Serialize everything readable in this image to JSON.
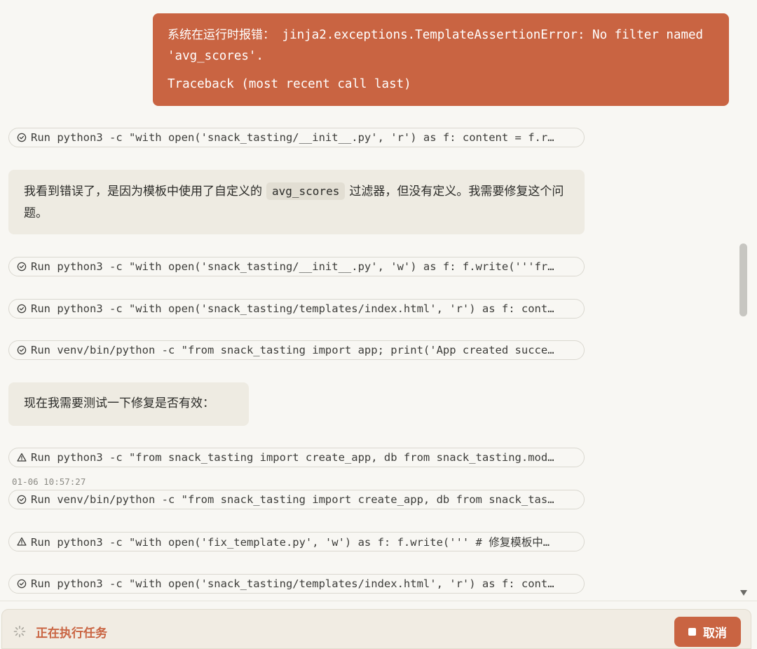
{
  "user_message": {
    "line1_prefix": "系统在运行时报错：",
    "line1_code": " jinja2.exceptions.TemplateAssertionError: No filter named 'avg_scores'.",
    "line2": "Traceback (most recent call last)"
  },
  "steps": [
    {
      "icon": "check-circle-icon",
      "text": "Run python3 -c \"with open('snack_tasting/__init__.py', 'r') as f: content = f.r…"
    },
    {
      "icon": "check-circle-icon",
      "text": "Run python3 -c \"with open('snack_tasting/__init__.py', 'w') as f: f.write('''fr…"
    },
    {
      "icon": "check-circle-icon",
      "text": "Run python3 -c \"with open('snack_tasting/templates/index.html', 'r') as f: cont…"
    },
    {
      "icon": "check-circle-icon",
      "text": "Run venv/bin/python -c \"from snack_tasting import app; print('App created succe…"
    },
    {
      "icon": "warning-icon",
      "text": "Run python3 -c \"from snack_tasting import create_app, db from snack_tasting.mod…"
    },
    {
      "icon": "check-circle-icon",
      "text": "Run venv/bin/python -c \"from snack_tasting import create_app, db from snack_tas…"
    },
    {
      "icon": "warning-icon",
      "text": "Run python3 -c \"with open('fix_template.py', 'w') as f: f.write(''' # 修复模板中…"
    },
    {
      "icon": "check-circle-icon",
      "text": "Run python3 -c \"with open('snack_tasting/templates/index.html', 'r') as f: cont…"
    }
  ],
  "assistant_messages": {
    "msg1_before": "我看到错误了，是因为模板中使用了自定义的",
    "msg1_code": "avg_scores",
    "msg1_after": "过滤器，但没有定义。我需要修复这个问题。",
    "msg2": "现在我需要测试一下修复是否有效："
  },
  "timestamp": "01-06 10:57:27",
  "status": {
    "text": "正在执行任务",
    "cancel_label": "取消"
  },
  "colors": {
    "accent": "#c96442",
    "background": "#f8f7f3",
    "assistant_bubble": "#eeebe2"
  }
}
